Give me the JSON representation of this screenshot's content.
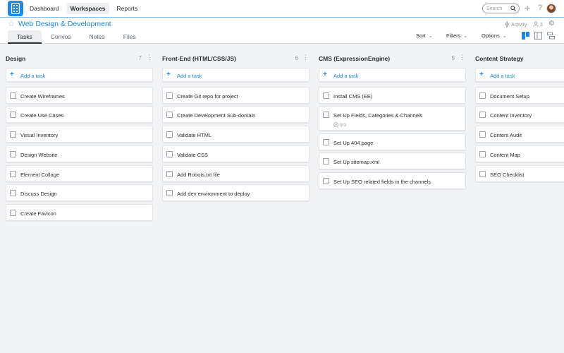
{
  "topbar": {
    "nav": [
      "Dashboard",
      "Workspaces",
      "Reports"
    ],
    "active_nav": "Workspaces",
    "search_placeholder": "Search",
    "help": "?"
  },
  "project": {
    "title": "Web Design & Development",
    "activity_label": "Activity",
    "member_count": "3"
  },
  "tabs": [
    "Tasks",
    "Convos",
    "Notes",
    "Files"
  ],
  "active_tab": "Tasks",
  "controls": {
    "sort": "Sort",
    "filters": "Filters",
    "options": "Options"
  },
  "accent_color": "#1e88e5",
  "board": {
    "add_task_label": "Add a task",
    "columns": [
      {
        "title": "Design",
        "count": "7",
        "tasks": [
          {
            "title": "Create Wireframes"
          },
          {
            "title": "Create Use Cases"
          },
          {
            "title": "Visual Inventory"
          },
          {
            "title": "Design Website"
          },
          {
            "title": "Element Collage"
          },
          {
            "title": "Discuss Design"
          },
          {
            "title": "Create Favicon"
          }
        ]
      },
      {
        "title": "Front-End (HTML/CSS/JS)",
        "count": "6",
        "tasks": [
          {
            "title": "Create Git repo for project"
          },
          {
            "title": "Create Development Sub-domain"
          },
          {
            "title": "Validate HTML"
          },
          {
            "title": "Validate CSS"
          },
          {
            "title": "Add Robots.txt file"
          },
          {
            "title": "Add dev environment to deploy"
          }
        ]
      },
      {
        "title": "CMS (ExpressionEngine)",
        "count": "5",
        "tasks": [
          {
            "title": "Install CMS (EE)"
          },
          {
            "title": "Set Up Fields, Categories & Channels",
            "checklist": "0/3"
          },
          {
            "title": "Set Up 404 page"
          },
          {
            "title": "Set Up sitemap.xml"
          },
          {
            "title": "Set Up SEO related fields in the channels"
          }
        ]
      },
      {
        "title": "Content Strategy",
        "count": "",
        "tasks": [
          {
            "title": "Document Setup"
          },
          {
            "title": "Content Inventory"
          },
          {
            "title": "Content Audit"
          },
          {
            "title": "Content Map"
          },
          {
            "title": "SEO Checklist"
          }
        ]
      }
    ]
  }
}
